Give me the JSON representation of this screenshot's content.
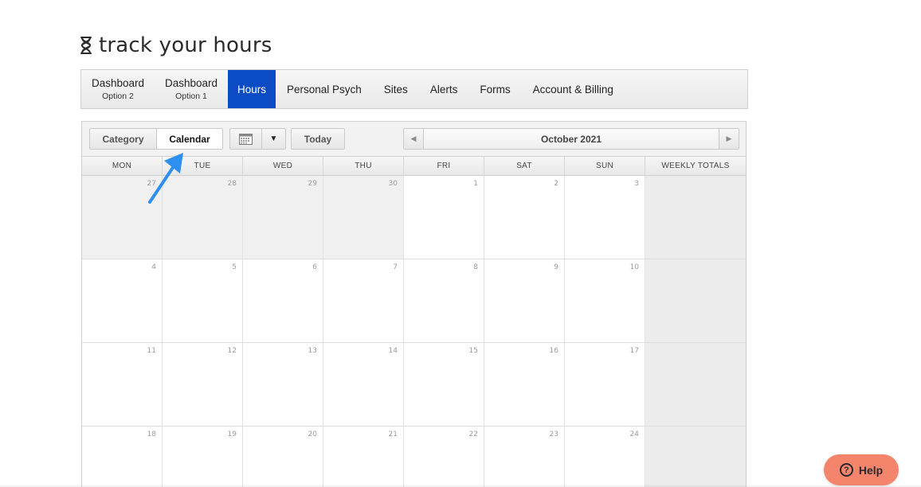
{
  "brand": {
    "title": "track your hours"
  },
  "nav": {
    "items": [
      {
        "label": "Dashboard",
        "sub": "Option 2"
      },
      {
        "label": "Dashboard",
        "sub": "Option 1"
      },
      {
        "label": "Hours"
      },
      {
        "label": "Personal Psych"
      },
      {
        "label": "Sites"
      },
      {
        "label": "Alerts"
      },
      {
        "label": "Forms"
      },
      {
        "label": "Account & Billing"
      }
    ],
    "active": "Hours"
  },
  "toolbar": {
    "view_toggle": [
      "Category",
      "Calendar"
    ],
    "selected_view": "Calendar",
    "today_label": "Today",
    "month_label": "October 2021",
    "prev_icon": "triangle-left-icon",
    "next_icon": "triangle-right-icon",
    "calendar_icon": "calendar-icon",
    "dropdown_icon": "caret-down-icon"
  },
  "calendar": {
    "headers": [
      "MON",
      "TUE",
      "WED",
      "THU",
      "FRI",
      "SAT",
      "SUN",
      "WEEKLY TOTALS"
    ],
    "weeks": [
      [
        "27",
        "28",
        "29",
        "30",
        "1",
        "2",
        "3"
      ],
      [
        "4",
        "5",
        "6",
        "7",
        "8",
        "9",
        "10"
      ],
      [
        "11",
        "12",
        "13",
        "14",
        "15",
        "16",
        "17"
      ],
      [
        "18",
        "19",
        "20",
        "21",
        "22",
        "23",
        "24"
      ]
    ],
    "other_month_days": [
      "27",
      "28",
      "29",
      "30"
    ]
  },
  "help": {
    "label": "Help",
    "icon": "question-circle-icon"
  },
  "colors": {
    "nav_active": "#0b4cc4",
    "help_button": "#f4846c",
    "annotation_arrow": "#2e8ff0"
  }
}
